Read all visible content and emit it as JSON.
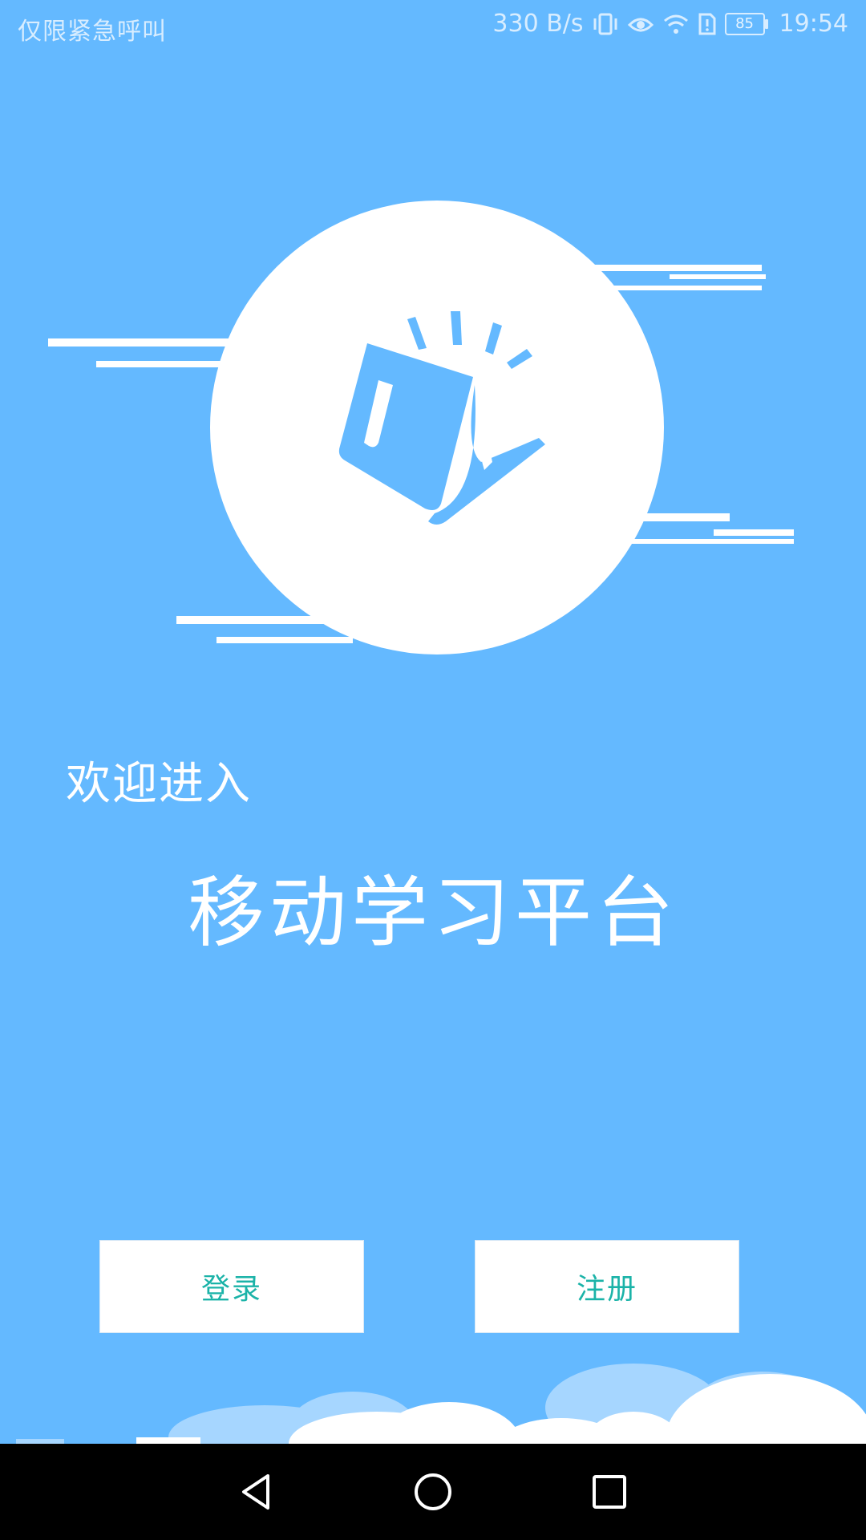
{
  "status_bar": {
    "left_text": "仅限紧急呼叫",
    "net_speed": "330 B/s",
    "battery": "85",
    "time": "19:54",
    "icons": [
      "vibrate-icon",
      "eye-icon",
      "wifi-icon",
      "sim-alert-icon",
      "battery-icon"
    ]
  },
  "hero": {
    "icon": "book-icon"
  },
  "welcome": {
    "greeting": "欢迎进入",
    "app_name": "移动学习平台"
  },
  "actions": {
    "login_label": "登录",
    "register_label": "注册"
  },
  "navigation": {
    "icons": [
      "back-icon",
      "home-icon",
      "recents-icon"
    ]
  },
  "colors": {
    "background": "#64B9FF",
    "button_text": "#1BB3A8",
    "nav_bar": "#000000"
  }
}
